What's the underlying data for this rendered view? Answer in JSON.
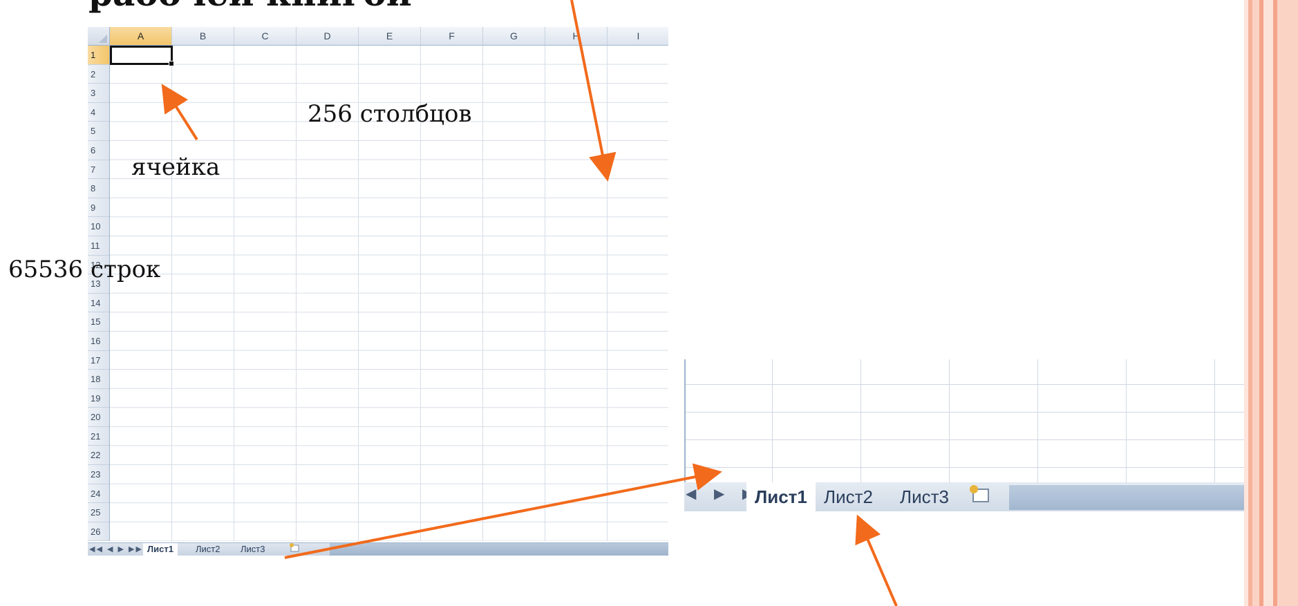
{
  "slide": {
    "title": "рабочей книгой"
  },
  "spreadsheet": {
    "columns": [
      "A",
      "B",
      "C",
      "D",
      "E",
      "F",
      "G",
      "H",
      "I"
    ],
    "rows": [
      "1",
      "2",
      "3",
      "4",
      "5",
      "6",
      "7",
      "8",
      "9",
      "10",
      "11",
      "12",
      "13",
      "14",
      "15",
      "16",
      "17",
      "18",
      "19",
      "20",
      "21",
      "22",
      "23",
      "24",
      "25",
      "26"
    ],
    "active_column": "A",
    "active_row": "1",
    "tabs": {
      "nav_glyphs": "◀◀ ◀ ▶ ▶▶",
      "sheet1": "Лист1",
      "sheet2": "Лист2",
      "sheet3": "Лист3"
    }
  },
  "inset": {
    "nav_glyphs": "◀ ▶ ▶|",
    "sheet1": "Лист1",
    "sheet2": "Лист2",
    "sheet3": "Лист3",
    "new_sheet_icon": "insert-sheet-icon"
  },
  "annotations": {
    "columns_label": "256 столбцов",
    "cell_label": "ячейка",
    "rows_label": "65536 строк"
  },
  "colors": {
    "arrow": "#f26a1b",
    "stripe_dark": "#f4a48a",
    "stripe_light": "#fbd3c4"
  }
}
